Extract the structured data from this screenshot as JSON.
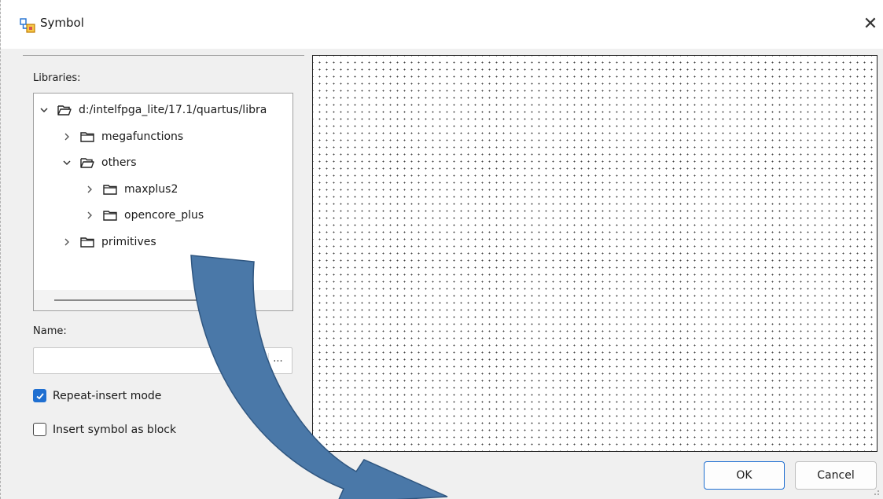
{
  "window": {
    "title": "Symbol",
    "title_icon": "symbol-app-icon",
    "close_glyph": "✕"
  },
  "libraries": {
    "label": "Libraries:",
    "tree": [
      {
        "label": "d:/intelfpga_lite/17.1/quartus/libra",
        "level": 0,
        "expanded": true,
        "icon": "folder-open-icon"
      },
      {
        "label": "megafunctions",
        "level": 1,
        "expanded": false,
        "icon": "folder-icon"
      },
      {
        "label": "others",
        "level": 1,
        "expanded": true,
        "icon": "folder-open-icon"
      },
      {
        "label": "maxplus2",
        "level": 2,
        "expanded": false,
        "icon": "folder-icon"
      },
      {
        "label": "opencore_plus",
        "level": 2,
        "expanded": false,
        "icon": "folder-icon"
      },
      {
        "label": "primitives",
        "level": 1,
        "expanded": false,
        "icon": "folder-icon"
      }
    ]
  },
  "name": {
    "label": "Name:",
    "value": "",
    "browse_label": "..."
  },
  "options": {
    "repeat_insert": {
      "label": "Repeat-insert mode",
      "checked": true
    },
    "insert_as_block": {
      "label": "Insert symbol as block",
      "checked": false
    }
  },
  "buttons": {
    "ok": "OK",
    "cancel": "Cancel"
  },
  "colors": {
    "accent": "#1f6fd1",
    "folder": "#f5d36b",
    "annotation_arrow": "#4a78a8"
  }
}
